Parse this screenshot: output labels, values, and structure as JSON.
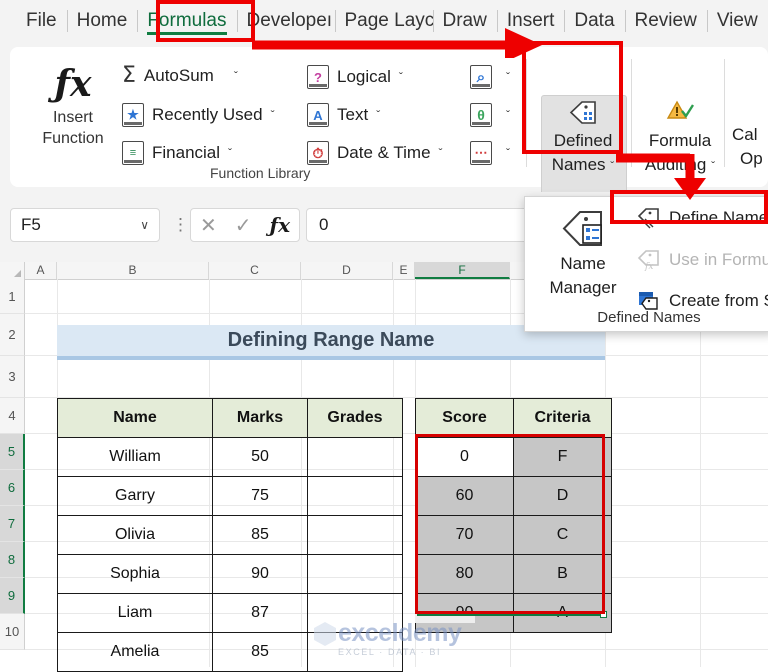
{
  "tabs": [
    {
      "label": "File",
      "active": false
    },
    {
      "label": "Home",
      "active": false
    },
    {
      "label": "Formulas",
      "active": true
    },
    {
      "label": "Developeı",
      "active": false
    },
    {
      "label": "Page Layc",
      "active": false
    },
    {
      "label": "Draw",
      "active": false
    },
    {
      "label": "Insert",
      "active": false
    },
    {
      "label": "Data",
      "active": false
    },
    {
      "label": "Review",
      "active": false
    },
    {
      "label": "View",
      "active": false
    }
  ],
  "ribbon": {
    "insert_function": {
      "line1": "Insert",
      "line2": "Function",
      "icon": "fx-icon",
      "glyph": "ƒx"
    },
    "function_library": {
      "group_label": "Function Library",
      "items": [
        {
          "label": "AutoSum",
          "icon": "sigma-icon",
          "glyph": "Σ",
          "chevron": "ˇ"
        },
        {
          "label": "Recently Used",
          "icon": "star-icon",
          "glyph": "★",
          "chevron": "ˇ"
        },
        {
          "label": "Financial",
          "icon": "financial-icon",
          "glyph": "≡",
          "chevron": "ˇ"
        },
        {
          "label": "Logical",
          "icon": "logical-icon",
          "glyph": "?",
          "chevron": "ˇ"
        },
        {
          "label": "Text",
          "icon": "text-icon",
          "glyph": "A",
          "chevron": "ˇ"
        },
        {
          "label": "Date & Time",
          "icon": "clock-icon",
          "glyph": "◔",
          "chevron": "ˇ"
        }
      ],
      "icon_only": [
        {
          "icon": "lookup-reference-icon",
          "glyph": "⌕",
          "chevron": "ˇ"
        },
        {
          "icon": "math-trig-icon",
          "glyph": "θ",
          "chevron": "ˇ"
        },
        {
          "icon": "more-functions-icon",
          "glyph": "⋯",
          "chevron": "ˇ"
        }
      ]
    },
    "defined_names_button": {
      "line1": "Defined",
      "line2": "Names",
      "chevron": "ˇ",
      "icon": "defined-names-icon"
    },
    "formula_auditing_button": {
      "line1": "Formula",
      "line2": "Auditing",
      "chevron": "ˇ",
      "icon": "formula-auditing-icon"
    },
    "calculation_button": {
      "line1": "Cal",
      "line2": "Op"
    }
  },
  "defined_names_panel": {
    "name_manager": {
      "line1": "Name",
      "line2": "Manager",
      "icon": "name-manager-icon"
    },
    "items": [
      {
        "label": "Define Name",
        "icon": "define-name-icon",
        "disabled": false,
        "highlighted": true
      },
      {
        "label": "Use in Formula",
        "icon": "use-in-formula-icon",
        "disabled": true,
        "highlighted": false
      },
      {
        "label": "Create from Sel",
        "icon": "create-from-selection-icon",
        "disabled": false,
        "highlighted": false
      }
    ],
    "group_label": "Defined Names"
  },
  "formula_bar": {
    "name_box_value": "F5",
    "name_box_chevron": "∨",
    "cancel_glyph": "✕",
    "enter_glyph": "✓",
    "fx_glyph": "ƒx",
    "formula_value": "0"
  },
  "grid": {
    "columns": [
      "A",
      "B",
      "C",
      "D",
      "E",
      "F"
    ],
    "selected_column": "F",
    "rows": [
      "1",
      "2",
      "3",
      "4",
      "5",
      "6",
      "7",
      "8",
      "9",
      "10"
    ],
    "selected_rows": [
      "5",
      "6",
      "7",
      "8",
      "9"
    ],
    "merged_title": "Defining Range Name"
  },
  "tables": {
    "left": {
      "headers": [
        "Name",
        "Marks",
        "Grades"
      ],
      "rows": [
        [
          "William",
          "50",
          ""
        ],
        [
          "Garry",
          "75",
          ""
        ],
        [
          "Olivia",
          "85",
          ""
        ],
        [
          "Sophia",
          "90",
          ""
        ],
        [
          "Liam",
          "87",
          ""
        ],
        [
          "Amelia",
          "85",
          ""
        ]
      ]
    },
    "right": {
      "headers": [
        "Score",
        "Criteria"
      ],
      "rows": [
        [
          "0",
          "F"
        ],
        [
          "60",
          "D"
        ],
        [
          "70",
          "C"
        ],
        [
          "80",
          "B"
        ],
        [
          "90",
          "A"
        ]
      ],
      "active_cell": "0"
    }
  },
  "watermark": {
    "line1": "exceldemy",
    "line2": "EXCEL · DATA · BI"
  },
  "colors": {
    "excel_green": "#107c41",
    "annotation_red": "#ee0000",
    "header_fill": "#e4ecd8",
    "title_fill": "#dbe8f4",
    "selection_gray": "#c6c6c6"
  }
}
